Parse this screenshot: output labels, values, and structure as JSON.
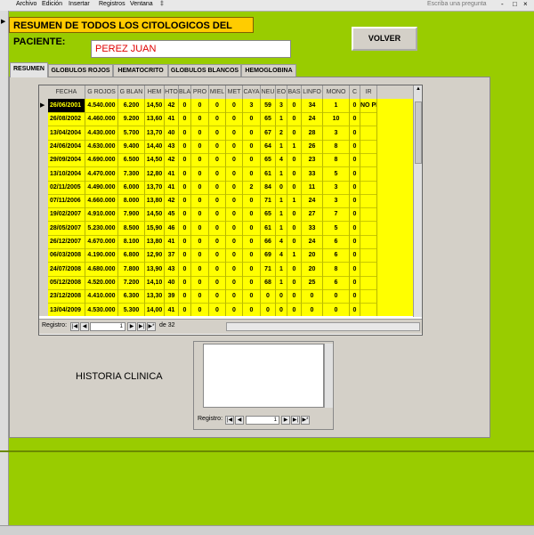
{
  "menu": {
    "items": [
      "Archivo",
      "Edición",
      "Insertar",
      "Registros",
      "Ventana",
      "‡"
    ],
    "ask_placeholder": "Escriba una pregunta",
    "window_buttons": [
      "-",
      "□",
      "×"
    ]
  },
  "title": "RESUMEN DE TODOS LOS CITOLOGICOS DEL PACIENTE:",
  "patient_name": "PEREZ JUAN",
  "volver_label": "VOLVER",
  "tabs": [
    {
      "label": "RESUMEN",
      "active": true
    },
    {
      "label": "GLOBULOS ROJOS",
      "active": false
    },
    {
      "label": "HEMATOCRITO",
      "active": false
    },
    {
      "label": "GLOBULOS BLANCOS",
      "active": false
    },
    {
      "label": "HEMOGLOBINA",
      "active": false
    }
  ],
  "grid": {
    "columns": [
      "FECHA",
      "G ROJOS",
      "G BLAN",
      "HEM",
      "HTO",
      "BLA",
      "PRO",
      "MIEL",
      "MET",
      "CAYA",
      "NEU",
      "EO",
      "BAS",
      "LINFO",
      "MONO",
      "C",
      "IR"
    ],
    "rows": [
      [
        "26/06/2001",
        "4.540.000",
        "6.200",
        "14,50",
        "42",
        "0",
        "0",
        "0",
        "0",
        "3",
        "59",
        "3",
        "0",
        "34",
        "1",
        "0",
        "NO PI"
      ],
      [
        "26/08/2002",
        "4.460.000",
        "9.200",
        "13,60",
        "41",
        "0",
        "0",
        "0",
        "0",
        "0",
        "65",
        "1",
        "0",
        "24",
        "10",
        "0",
        ""
      ],
      [
        "13/04/2004",
        "4.430.000",
        "5.700",
        "13,70",
        "40",
        "0",
        "0",
        "0",
        "0",
        "0",
        "67",
        "2",
        "0",
        "28",
        "3",
        "0",
        ""
      ],
      [
        "24/06/2004",
        "4.630.000",
        "9.400",
        "14,40",
        "43",
        "0",
        "0",
        "0",
        "0",
        "0",
        "64",
        "1",
        "1",
        "26",
        "8",
        "0",
        ""
      ],
      [
        "29/09/2004",
        "4.690.000",
        "6.500",
        "14,50",
        "42",
        "0",
        "0",
        "0",
        "0",
        "0",
        "65",
        "4",
        "0",
        "23",
        "8",
        "0",
        ""
      ],
      [
        "13/10/2004",
        "4.470.000",
        "7.300",
        "12,80",
        "41",
        "0",
        "0",
        "0",
        "0",
        "0",
        "61",
        "1",
        "0",
        "33",
        "5",
        "0",
        ""
      ],
      [
        "02/11/2005",
        "4.490.000",
        "6.000",
        "13,70",
        "41",
        "0",
        "0",
        "0",
        "0",
        "2",
        "84",
        "0",
        "0",
        "11",
        "3",
        "0",
        ""
      ],
      [
        "07/11/2006",
        "4.660.000",
        "8.000",
        "13,80",
        "42",
        "0",
        "0",
        "0",
        "0",
        "0",
        "71",
        "1",
        "1",
        "24",
        "3",
        "0",
        ""
      ],
      [
        "19/02/2007",
        "4.910.000",
        "7.900",
        "14,50",
        "45",
        "0",
        "0",
        "0",
        "0",
        "0",
        "65",
        "1",
        "0",
        "27",
        "7",
        "0",
        ""
      ],
      [
        "28/05/2007",
        "5.230.000",
        "8.500",
        "15,90",
        "46",
        "0",
        "0",
        "0",
        "0",
        "0",
        "61",
        "1",
        "0",
        "33",
        "5",
        "0",
        ""
      ],
      [
        "26/12/2007",
        "4.670.000",
        "8.100",
        "13,80",
        "41",
        "0",
        "0",
        "0",
        "0",
        "0",
        "66",
        "4",
        "0",
        "24",
        "6",
        "0",
        ""
      ],
      [
        "06/03/2008",
        "4.190.000",
        "6.800",
        "12,90",
        "37",
        "0",
        "0",
        "0",
        "0",
        "0",
        "69",
        "4",
        "1",
        "20",
        "6",
        "0",
        ""
      ],
      [
        "24/07/2008",
        "4.680.000",
        "7.800",
        "13,90",
        "43",
        "0",
        "0",
        "0",
        "0",
        "0",
        "71",
        "1",
        "0",
        "20",
        "8",
        "0",
        ""
      ],
      [
        "05/12/2008",
        "4.520.000",
        "7.200",
        "14,10",
        "40",
        "0",
        "0",
        "0",
        "0",
        "0",
        "68",
        "1",
        "0",
        "25",
        "6",
        "0",
        ""
      ],
      [
        "23/12/2008",
        "4.410.000",
        "6.300",
        "13,30",
        "39",
        "0",
        "0",
        "0",
        "0",
        "0",
        "0",
        "0",
        "0",
        "0",
        "0",
        "0",
        ""
      ],
      [
        "13/04/2009",
        "4.530.000",
        "5.300",
        "14,00",
        "41",
        "0",
        "0",
        "0",
        "0",
        "0",
        "0",
        "0",
        "0",
        "0",
        "0",
        "0",
        ""
      ]
    ],
    "record_label": "Registro:",
    "record_current": "1",
    "record_total": "de 32"
  },
  "historia_label": "HISTORIA CLINICA",
  "subform": {
    "record_label": "Registro:",
    "record_current": "1"
  },
  "colors": {
    "background": "#99cc00",
    "title_bg": "#ffcc00",
    "grid_rows": "#ffff00",
    "patient_text": "#e00000"
  }
}
